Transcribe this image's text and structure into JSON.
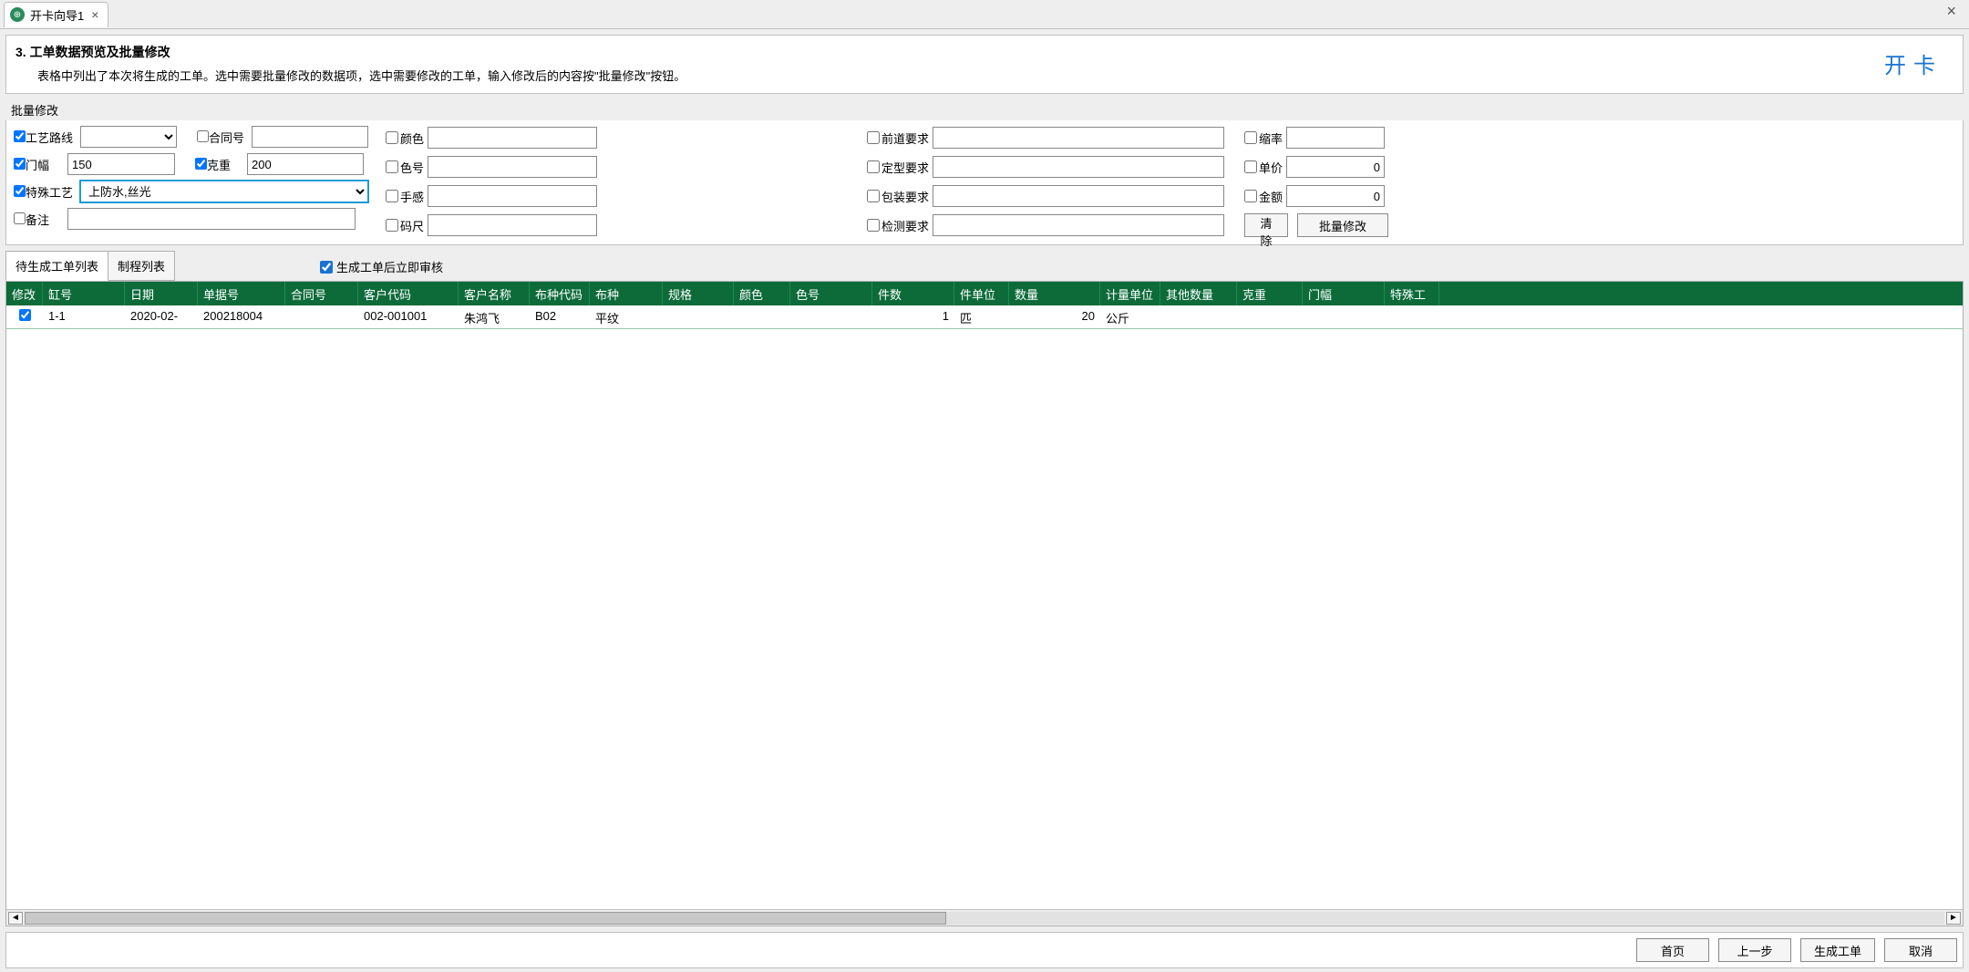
{
  "tab": {
    "title": "开卡向导1"
  },
  "window": {
    "close": "×"
  },
  "instruction": {
    "step": "3.",
    "title": "工单数据预览及批量修改",
    "desc": "表格中列出了本次将生成的工单。选中需要批量修改的数据项，选中需要修改的工单，输入修改后的内容按\"批量修改\"按钮。",
    "open_card": "开卡"
  },
  "batch": {
    "section_label": "批量修改",
    "process_route": {
      "label": "工艺路线",
      "value": ""
    },
    "contract_no": {
      "label": "合同号",
      "value": ""
    },
    "width": {
      "label": "门幅",
      "value": "150"
    },
    "weight": {
      "label": "克重",
      "value": "200"
    },
    "special_process": {
      "label": "特殊工艺",
      "value": "上防水,丝光"
    },
    "remark": {
      "label": "备注",
      "value": ""
    },
    "color": {
      "label": "颜色",
      "value": ""
    },
    "color_no": {
      "label": "色号",
      "value": ""
    },
    "feel": {
      "label": "手感",
      "value": ""
    },
    "ruler": {
      "label": "码尺",
      "value": ""
    },
    "pre_req": {
      "label": "前道要求",
      "value": ""
    },
    "shape_req": {
      "label": "定型要求",
      "value": ""
    },
    "pack_req": {
      "label": "包装要求",
      "value": ""
    },
    "inspect_req": {
      "label": "检测要求",
      "value": ""
    },
    "shrink": {
      "label": "缩率",
      "value": ""
    },
    "price": {
      "label": "单价",
      "value": "0"
    },
    "amount": {
      "label": "金额",
      "value": "0"
    },
    "clear_btn": "清除",
    "batch_btn": "批量修改"
  },
  "sub_tabs": {
    "pending": "待生成工单列表",
    "process": "制程列表",
    "audit_check": "生成工单后立即审核"
  },
  "table": {
    "headers": [
      "修改",
      "缸号",
      "日期",
      "单据号",
      "合同号",
      "客户代码",
      "客户名称",
      "布种代码",
      "布种",
      "规格",
      "颜色",
      "色号",
      "件数",
      "件单位",
      "数量",
      "计量单位",
      "其他数量",
      "克重",
      "门幅",
      "特殊工"
    ],
    "rows": [
      {
        "modify": true,
        "vat_no": "1-1",
        "date": "2020-02-",
        "doc_no": "200218004",
        "contract_no": "",
        "cust_code": "002-001001",
        "cust_name": "朱鸿飞",
        "fabric_code": "B02",
        "fabric": "平纹",
        "spec": "",
        "color": "",
        "color_no": "",
        "pieces": "1",
        "piece_unit": "匹",
        "qty": "20",
        "unit": "公斤",
        "other_qty": "",
        "weight": "",
        "width": "",
        "special": ""
      }
    ]
  },
  "footer": {
    "home": "首页",
    "prev": "上一步",
    "generate": "生成工单",
    "cancel": "取消"
  }
}
